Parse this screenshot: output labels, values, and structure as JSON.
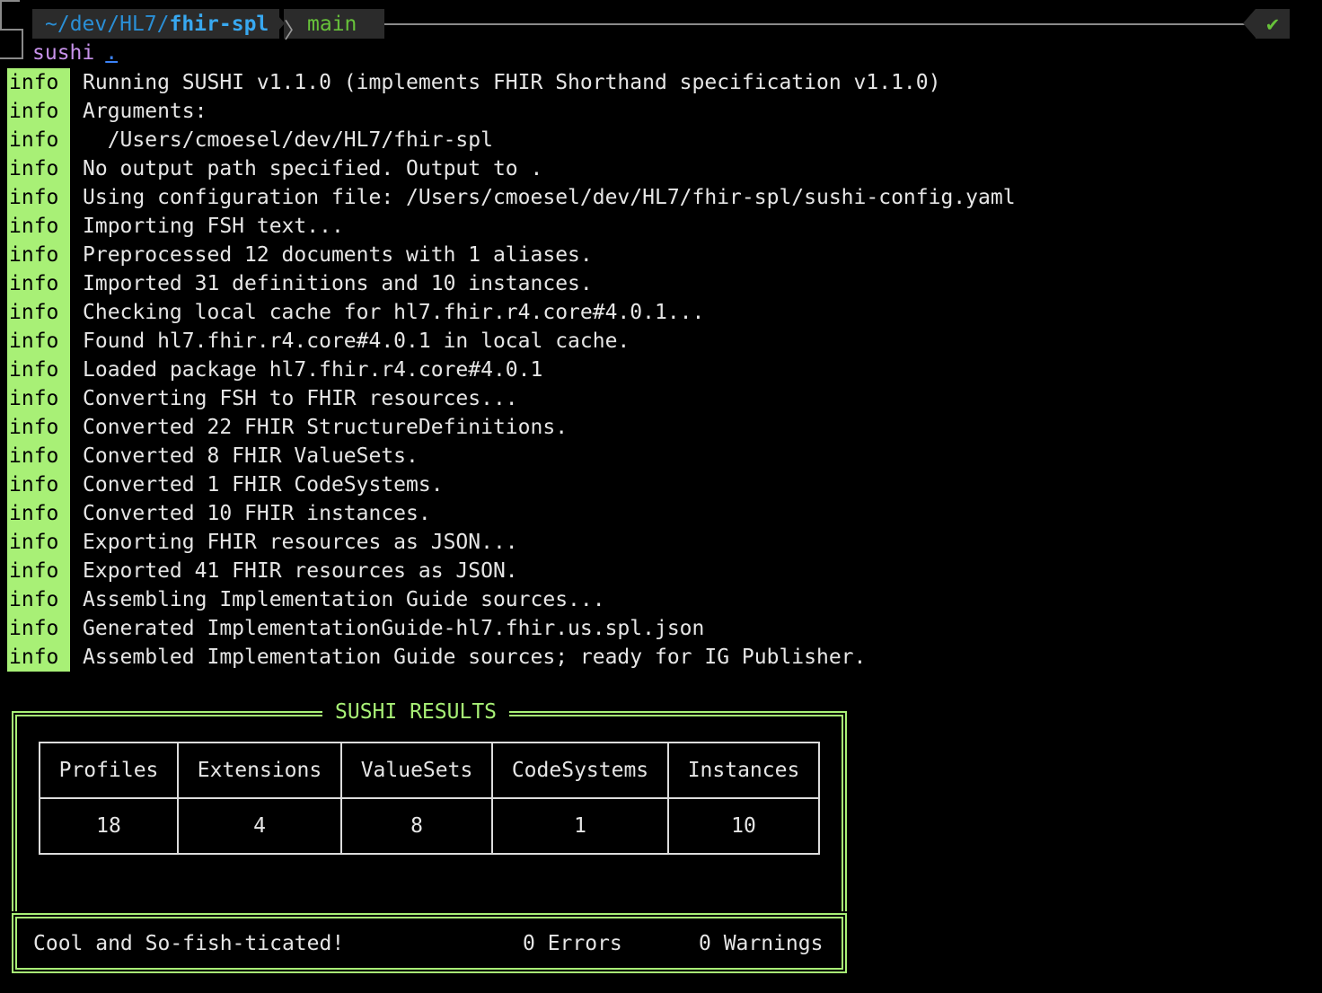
{
  "prompt": {
    "path_prefix": "~/dev/HL7/",
    "path_current": "fhir-spl",
    "separator": "〉",
    "branch": "main",
    "status_icon": "✔",
    "command": "sushi",
    "command_arg": "."
  },
  "log": {
    "tag": "info",
    "lines": [
      "Running SUSHI v1.1.0 (implements FHIR Shorthand specification v1.1.0)",
      "Arguments:",
      "  /Users/cmoesel/dev/HL7/fhir-spl",
      "No output path specified. Output to .",
      "Using configuration file: /Users/cmoesel/dev/HL7/fhir-spl/sushi-config.yaml",
      "Importing FSH text...",
      "Preprocessed 12 documents with 1 aliases.",
      "Imported 31 definitions and 10 instances.",
      "Checking local cache for hl7.fhir.r4.core#4.0.1...",
      "Found hl7.fhir.r4.core#4.0.1 in local cache.",
      "Loaded package hl7.fhir.r4.core#4.0.1",
      "Converting FSH to FHIR resources...",
      "Converted 22 FHIR StructureDefinitions.",
      "Converted 8 FHIR ValueSets.",
      "Converted 1 FHIR CodeSystems.",
      "Converted 10 FHIR instances.",
      "Exporting FHIR resources as JSON...",
      "Exported 41 FHIR resources as JSON.",
      "Assembling Implementation Guide sources...",
      "Generated ImplementationGuide-hl7.fhir.us.spl.json",
      "Assembled Implementation Guide sources; ready for IG Publisher."
    ]
  },
  "results": {
    "title": "SUSHI RESULTS",
    "headers": [
      "Profiles",
      "Extensions",
      "ValueSets",
      "CodeSystems",
      "Instances"
    ],
    "values": [
      "18",
      "4",
      "8",
      "1",
      "10"
    ],
    "footer_message": "Cool and So-fish-ticated!",
    "errors": "0 Errors",
    "warnings": "0 Warnings"
  },
  "colors": {
    "info_tag_bg": "#a8f076",
    "branch": "#67c23a",
    "path": "#38a8f0",
    "command": "#c792ea"
  }
}
